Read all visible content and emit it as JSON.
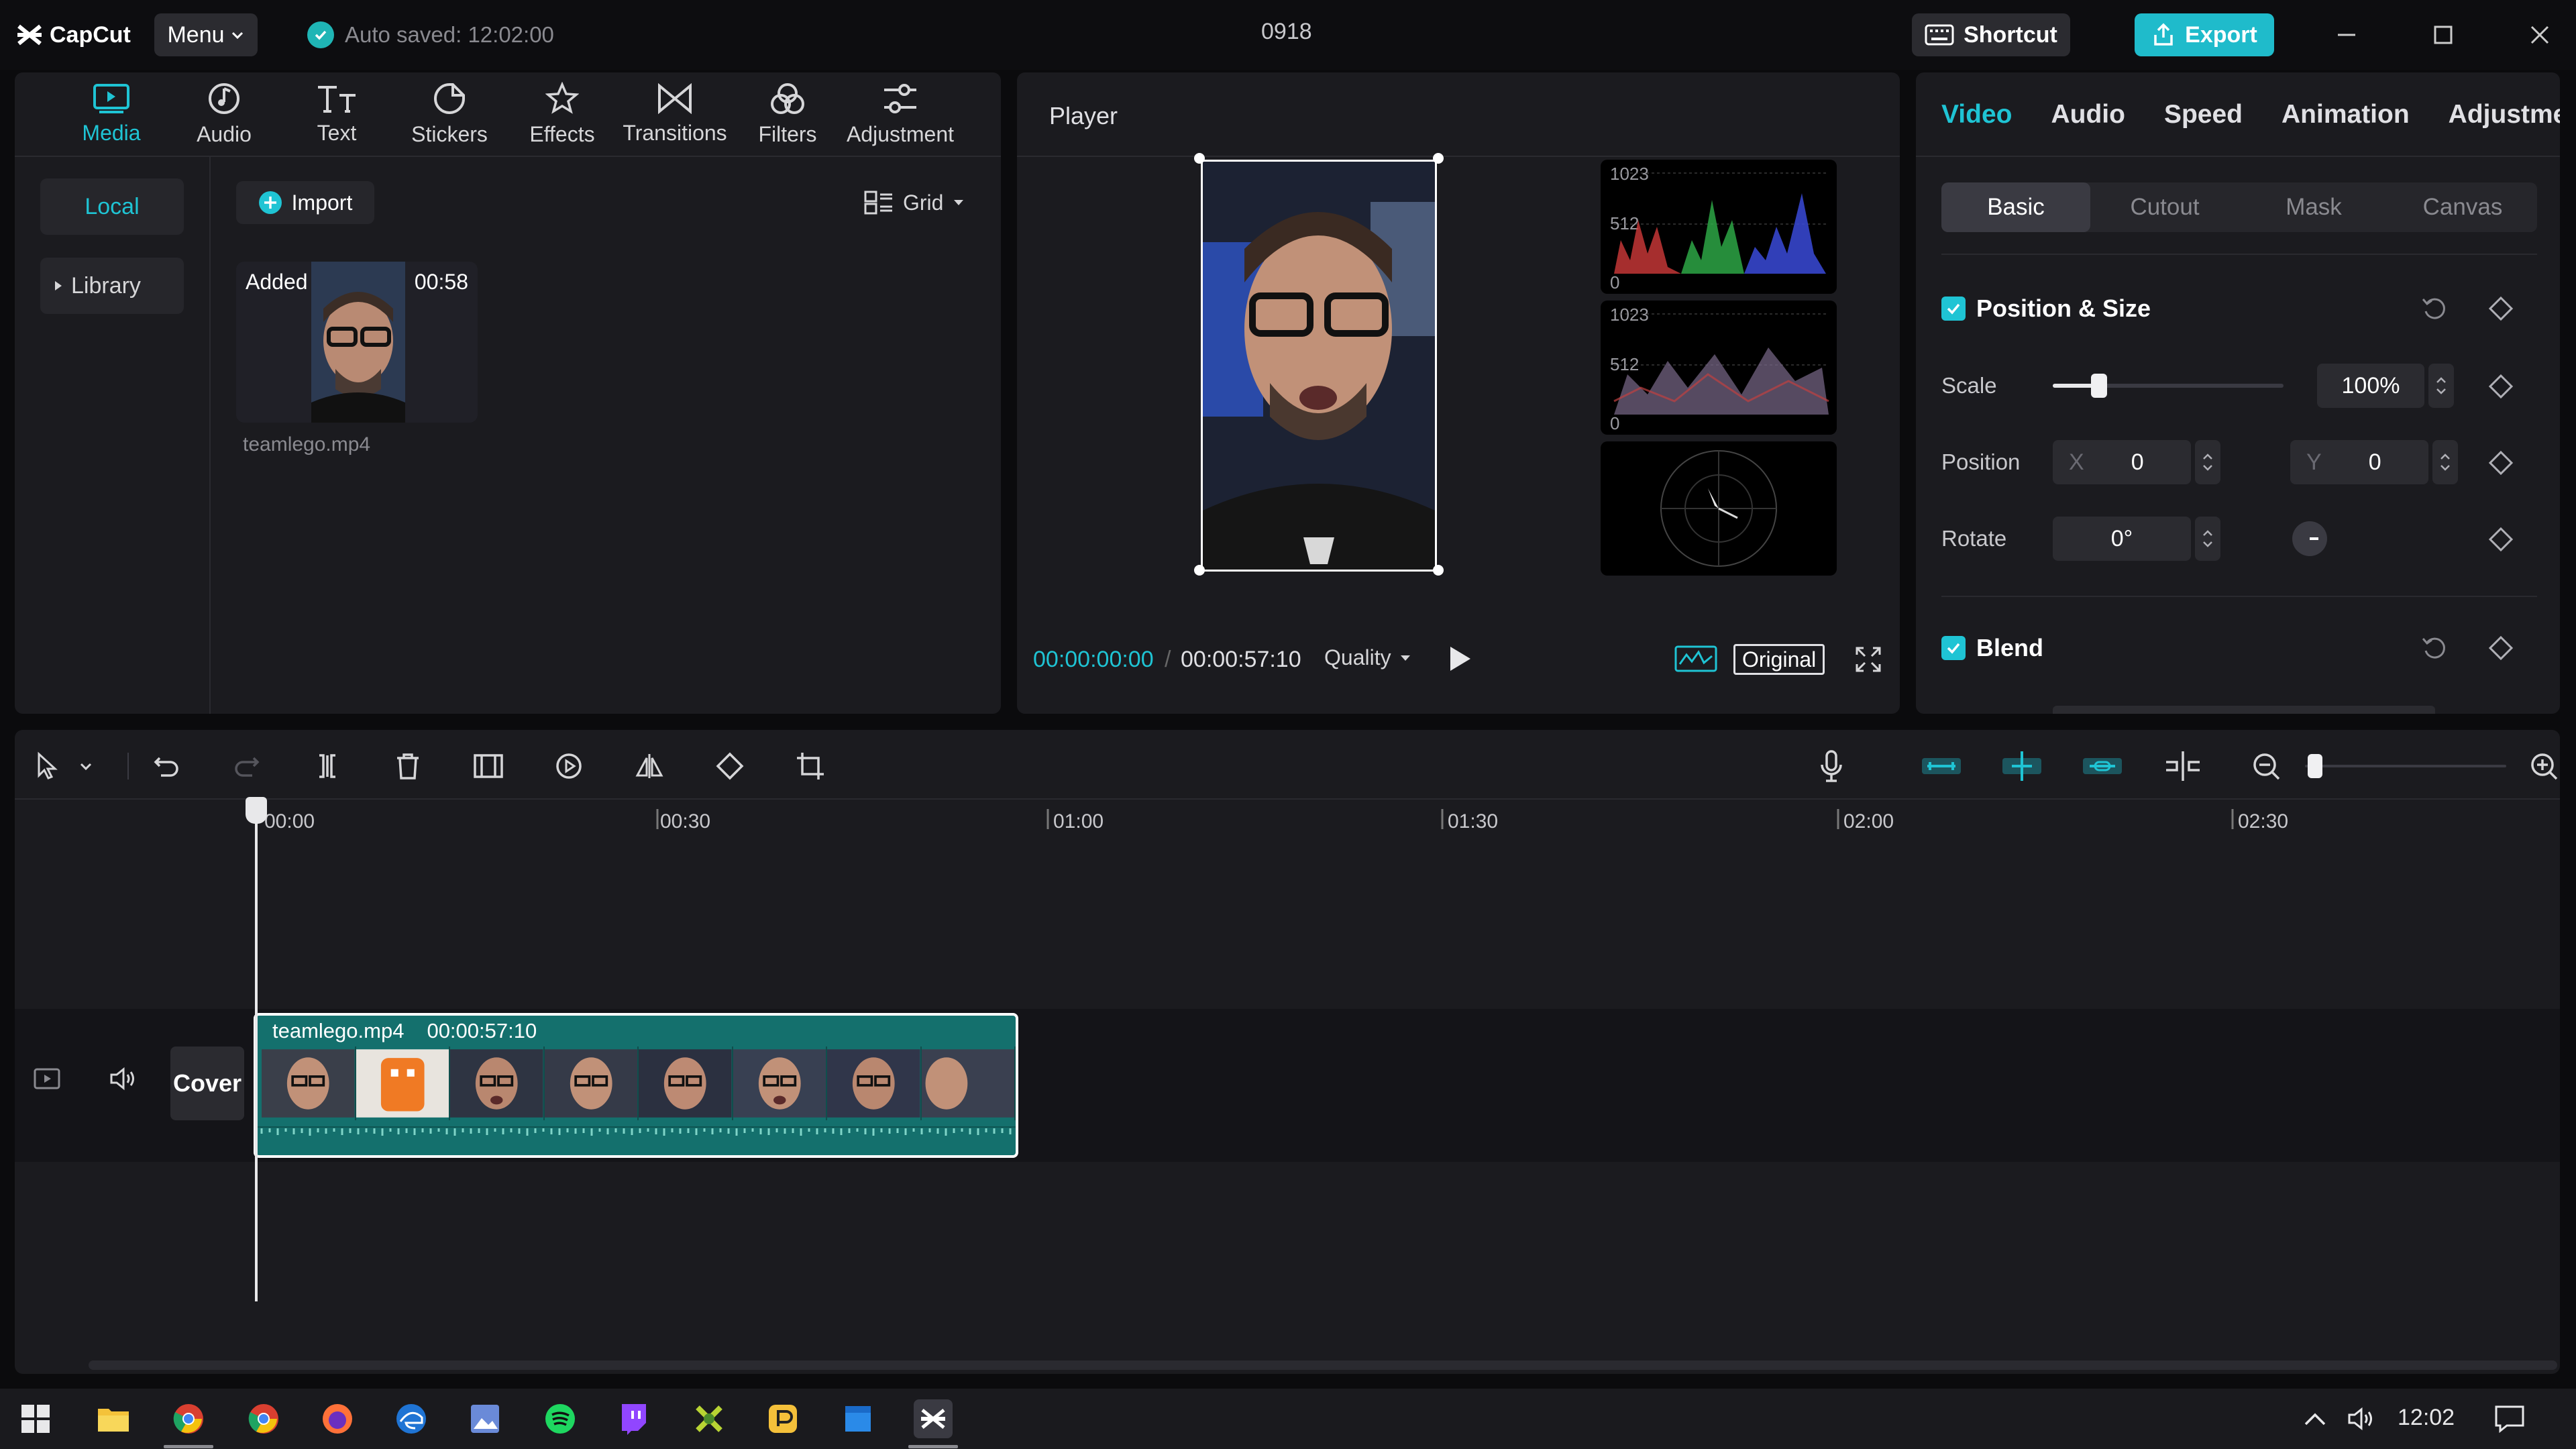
{
  "app": {
    "logo_text": "CapCut",
    "menu_label": "Menu",
    "autosave_text": "Auto saved: 12:02:00",
    "project_name": "0918",
    "shortcut_label": "Shortcut",
    "export_label": "Export"
  },
  "media_tabs": [
    {
      "label": "Media",
      "icon": "media-icon",
      "active": true
    },
    {
      "label": "Audio",
      "icon": "audio-icon"
    },
    {
      "label": "Text",
      "icon": "text-icon"
    },
    {
      "label": "Stickers",
      "icon": "sticker-icon"
    },
    {
      "label": "Effects",
      "icon": "effects-icon"
    },
    {
      "label": "Transitions",
      "icon": "transitions-icon"
    },
    {
      "label": "Filters",
      "icon": "filters-icon"
    },
    {
      "label": "Adjustment",
      "icon": "adjustment-icon"
    }
  ],
  "media_sidebar": {
    "local": "Local",
    "library": "Library"
  },
  "media_toolbar": {
    "import_label": "Import",
    "view_label": "Grid"
  },
  "media_item": {
    "badge": "Added",
    "duration": "00:58",
    "filename": "teamlego.mp4"
  },
  "player": {
    "title": "Player",
    "current_time": "00:00:00:00",
    "total_time": "00:00:57:10",
    "quality_label": "Quality",
    "ratio_label": "Original",
    "scope_labels": {
      "top": "1023",
      "mid": "512",
      "zero": "0"
    }
  },
  "properties": {
    "tabs": [
      "Video",
      "Audio",
      "Speed",
      "Animation",
      "Adjustme"
    ],
    "subtabs": [
      "Basic",
      "Cutout",
      "Mask",
      "Canvas"
    ],
    "position_size": {
      "title": "Position & Size",
      "scale_label": "Scale",
      "scale_value": "100%",
      "scale_slider_fraction": 0.2,
      "position_label": "Position",
      "x_label": "X",
      "x_value": "0",
      "y_label": "Y",
      "y_value": "0",
      "rotate_label": "Rotate",
      "rotate_value": "0°"
    },
    "blend_title": "Blend"
  },
  "timeline": {
    "ruler_labels": [
      "00:00",
      "00:30",
      "01:00",
      "01:30",
      "02:00",
      "02:30"
    ],
    "cover_label": "Cover",
    "clip_name": "teamlego.mp4",
    "clip_duration": "00:00:57:10",
    "zoom_fraction": 0.05
  },
  "taskbar": {
    "time": "12:02"
  },
  "colors": {
    "accent": "#1fc4d4",
    "export": "#1fbbcb",
    "clip": "#14706d"
  }
}
